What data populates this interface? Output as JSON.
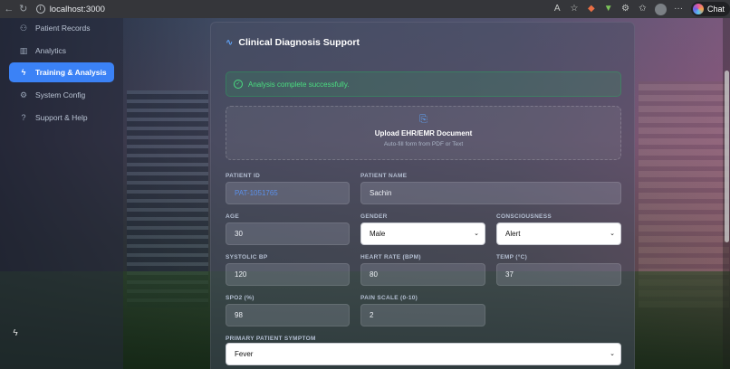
{
  "browser": {
    "url": "localhost:3000",
    "chat_label": "Chat"
  },
  "sidebar": {
    "items": [
      {
        "label": "Patient Records",
        "icon": "users-icon"
      },
      {
        "label": "Analytics",
        "icon": "bar-chart-icon"
      },
      {
        "label": "Training & Analysis",
        "icon": "bolt-icon",
        "active": true
      },
      {
        "label": "System Config",
        "icon": "gear-icon"
      },
      {
        "label": "Support & Help",
        "icon": "help-icon"
      }
    ]
  },
  "main": {
    "title": "Clinical Diagnosis Support",
    "alert": "Analysis complete successfully.",
    "upload": {
      "title": "Upload EHR/EMR Document",
      "subtitle": "Auto-fill form from PDF or Text"
    },
    "fields": {
      "patient_id": {
        "label": "PATIENT ID",
        "value": "PAT-1051765"
      },
      "patient_name": {
        "label": "PATIENT NAME",
        "value": "Sachin"
      },
      "age": {
        "label": "AGE",
        "value": "30"
      },
      "gender": {
        "label": "GENDER",
        "value": "Male"
      },
      "consciousness": {
        "label": "CONSCIOUSNESS",
        "value": "Alert"
      },
      "systolic_bp": {
        "label": "SYSTOLIC BP",
        "value": "120"
      },
      "heart_rate": {
        "label": "HEART RATE (BPM)",
        "value": "80"
      },
      "temp": {
        "label": "TEMP (°C)",
        "value": "37"
      },
      "spo2": {
        "label": "SPO2 (%)",
        "value": "98"
      },
      "pain_scale": {
        "label": "PAIN SCALE (0-10)",
        "value": "2"
      },
      "primary_symptom": {
        "label": "PRIMARY PATIENT SYMPTOM",
        "value": "Fever"
      }
    }
  },
  "colors": {
    "accent": "#3b82f6",
    "success": "#4ade80"
  }
}
